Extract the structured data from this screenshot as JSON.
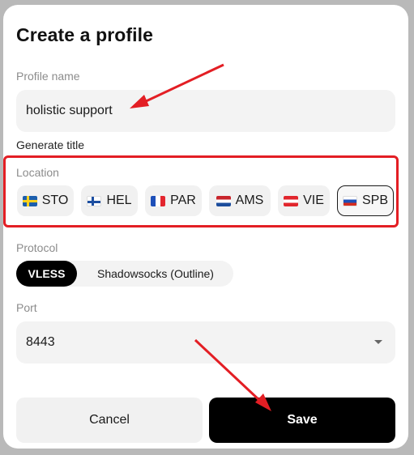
{
  "dialog": {
    "title": "Create a profile",
    "profile_name_label": "Profile name",
    "profile_name_value": "holistic support",
    "generate_title_link": "Generate title",
    "location_label": "Location",
    "locations": [
      {
        "code": "STO",
        "flag": "sweden-flag-icon",
        "selected": false
      },
      {
        "code": "HEL",
        "flag": "finland-flag-icon",
        "selected": false
      },
      {
        "code": "PAR",
        "flag": "france-flag-icon",
        "selected": false
      },
      {
        "code": "AMS",
        "flag": "netherlands-flag-icon",
        "selected": false
      },
      {
        "code": "VIE",
        "flag": "austria-flag-icon",
        "selected": false
      },
      {
        "code": "SPB",
        "flag": "russia-flag-icon",
        "selected": true
      }
    ],
    "protocol_label": "Protocol",
    "protocols": [
      {
        "label": "VLESS",
        "active": true
      },
      {
        "label": "Shadowsocks (Outline)",
        "active": false
      }
    ],
    "port_label": "Port",
    "port_value": "8443",
    "cancel_label": "Cancel",
    "save_label": "Save"
  },
  "colors": {
    "accent": "#000000",
    "annotation": "#e31e24",
    "field_bg": "#f3f3f3",
    "muted_label": "#8c8c8c"
  }
}
